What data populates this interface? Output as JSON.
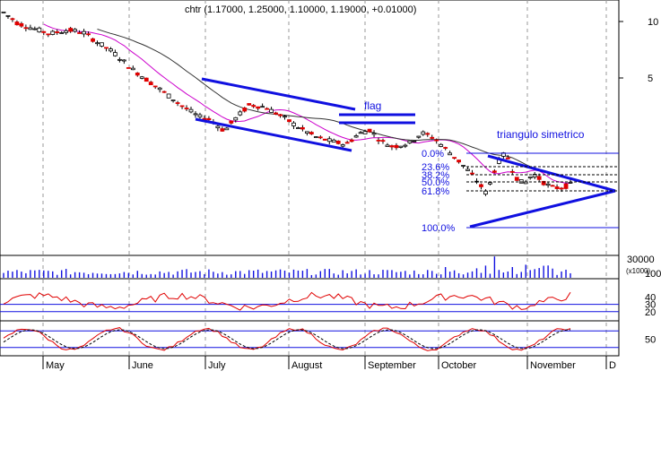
{
  "chart_data": {
    "type": "candlestick",
    "title": "chtr (1.17000, 1.25000, 1.10000, 1.19000, +0.01000)",
    "price_scale": "log",
    "price_ticks": [
      10,
      5
    ],
    "months": [
      "May",
      "June",
      "July",
      "August",
      "September",
      "October",
      "November",
      "D"
    ],
    "annotations": {
      "flag": "flag",
      "triangle": "triangulo simetrico",
      "fib_levels": [
        "0.0%",
        "23.6%",
        "38.2%",
        "50.0%",
        "61.8%",
        "100.0%"
      ]
    },
    "price_anchors": [
      [
        0,
        11.2
      ],
      [
        12,
        9.8
      ],
      [
        25,
        9.2
      ],
      [
        40,
        8.6
      ],
      [
        55,
        9.0
      ],
      [
        68,
        8.8
      ],
      [
        80,
        7.8
      ],
      [
        95,
        6.8
      ],
      [
        110,
        5.6
      ],
      [
        125,
        4.8
      ],
      [
        140,
        4.1
      ],
      [
        155,
        3.5
      ],
      [
        168,
        3.1
      ],
      [
        178,
        3.0
      ],
      [
        190,
        2.6
      ],
      [
        200,
        3.05
      ],
      [
        212,
        3.6
      ],
      [
        225,
        3.5
      ],
      [
        240,
        3.1
      ],
      [
        255,
        2.7
      ],
      [
        270,
        2.4
      ],
      [
        282,
        2.3
      ],
      [
        295,
        2.2
      ],
      [
        305,
        2.5
      ],
      [
        315,
        2.65
      ],
      [
        325,
        2.3
      ],
      [
        335,
        2.15
      ],
      [
        350,
        2.25
      ],
      [
        360,
        2.55
      ],
      [
        370,
        2.4
      ],
      [
        382,
        2.05
      ],
      [
        392,
        1.8
      ],
      [
        404,
        1.5
      ],
      [
        416,
        1.2
      ],
      [
        425,
        1.75
      ],
      [
        432,
        2.0
      ],
      [
        440,
        1.5
      ],
      [
        448,
        1.35
      ],
      [
        456,
        1.55
      ],
      [
        464,
        1.4
      ],
      [
        472,
        1.3
      ],
      [
        480,
        1.3
      ],
      [
        488,
        1.35
      ]
    ],
    "volume_ticks": [
      "30000",
      "100",
      "(x1000)"
    ],
    "rsi_ticks": [
      40,
      30,
      20
    ],
    "stoch_ticks": [
      50
    ]
  }
}
